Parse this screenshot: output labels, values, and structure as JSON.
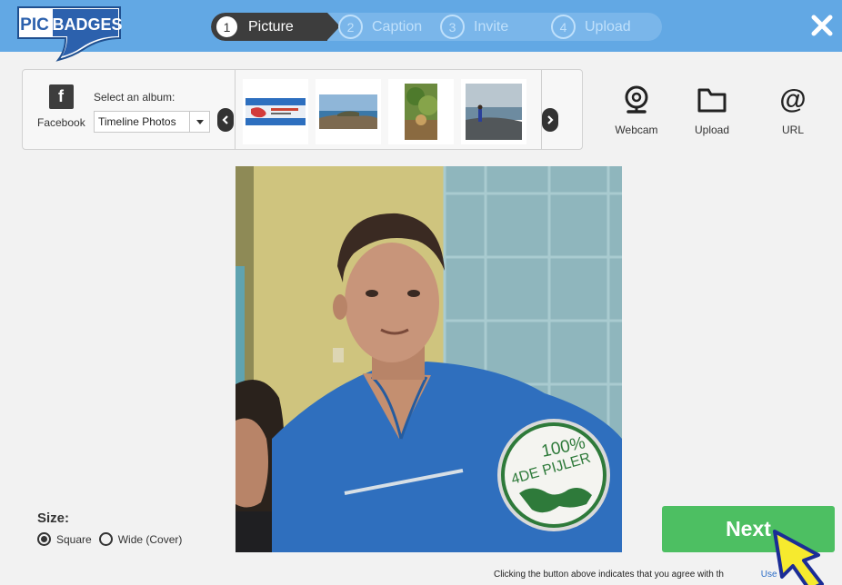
{
  "logo": {
    "left": "PIC",
    "right": "BADGES"
  },
  "steps": [
    {
      "num": "1",
      "label": "Picture",
      "active": true
    },
    {
      "num": "2",
      "label": "Caption",
      "active": false
    },
    {
      "num": "3",
      "label": "Invite",
      "active": false
    },
    {
      "num": "4",
      "label": "Upload",
      "active": false
    }
  ],
  "source": {
    "facebook_label": "Facebook",
    "facebook_glyph": "f",
    "album_label": "Select an album:",
    "album_value": "Timeline Photos",
    "options": [
      {
        "label": "Webcam",
        "icon": "webcam-icon"
      },
      {
        "label": "Upload",
        "icon": "folder-icon"
      },
      {
        "label": "URL",
        "icon": "at-icon"
      }
    ]
  },
  "badge": {
    "line1": "100%",
    "line2": "4DE PIJLER"
  },
  "size": {
    "title": "Size:",
    "options": [
      {
        "label": "Square",
        "selected": true
      },
      {
        "label": "Wide (Cover)",
        "selected": false
      }
    ]
  },
  "next_label": "Next",
  "terms": {
    "text": "Clicking the button above indicates that you agree with th",
    "link_fragment": "Use"
  },
  "colors": {
    "header": "#62a8e4",
    "next": "#4dbf62",
    "active_step": "#3d3d3d"
  }
}
